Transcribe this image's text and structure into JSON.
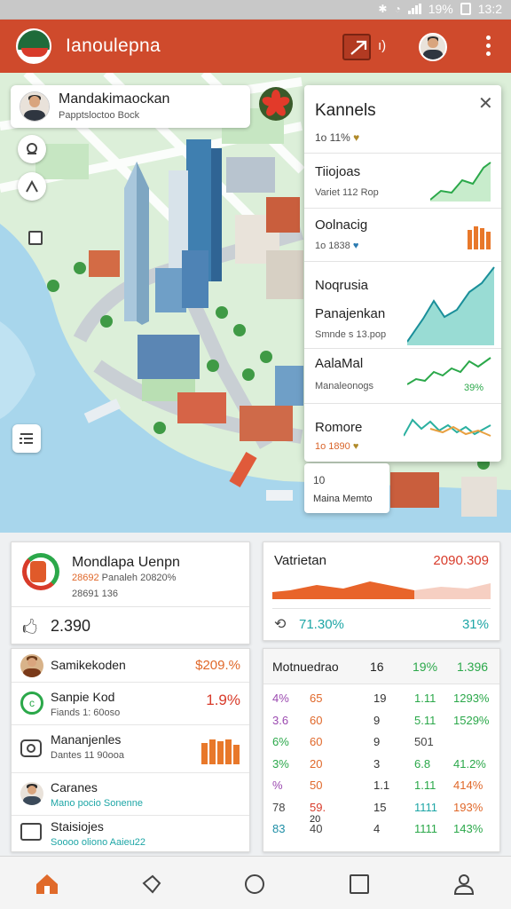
{
  "status": {
    "battery": "19%",
    "time": "13:2"
  },
  "app": {
    "title": "Ianoulepna",
    "volume_label": "ı)"
  },
  "map_card": {
    "name": "Mandakimaockan",
    "subtitle": "Papptsloctoo Bock"
  },
  "panel": {
    "title": "Kannels",
    "subtitle": "1o 11%",
    "items": [
      {
        "title": "Tiiojoas",
        "subtitle": "Variet 112 Rop"
      },
      {
        "title": "Oolnacig",
        "subtitle": "1o 1838"
      },
      {
        "title": "Noqrusia",
        "subtitle": ""
      },
      {
        "title": "Panajenkan",
        "subtitle": "Smnde s 13.pop"
      },
      {
        "title": "AalaMal",
        "subtitle": "Manaleonogs",
        "value": "39%"
      },
      {
        "title": "Romore",
        "subtitle": "1o 1890"
      }
    ]
  },
  "map_menu": {
    "line1": "10",
    "line2": "Maina Memto"
  },
  "left_card": {
    "title": "Mondlapa Uenpn",
    "sub1": "28692",
    "sub2": "Panaleh 20820%",
    "sub3": "28691 136",
    "value": "2.390"
  },
  "list": [
    {
      "title": "Samikekoden",
      "sub": "",
      "value": "$209.%"
    },
    {
      "title": "Sanpie Kod",
      "sub": "Fiands 1: 60oso",
      "value": "1.9%"
    },
    {
      "title": "Mananjenles",
      "sub": "Dantes 11 90ooa",
      "value": ""
    },
    {
      "title": "Caranes",
      "sub": "Mano pocio Sonenne",
      "value": ""
    },
    {
      "title": "Staisiojes",
      "sub": "Soooo oliono Aaieu22",
      "value": ""
    }
  ],
  "chart_card": {
    "title": "Vatrietan",
    "value": "2090.309",
    "footer_left": "71.30%",
    "footer_right": "31%"
  },
  "table": {
    "header": [
      "Motnuedrao",
      "16",
      "19%",
      "1.396"
    ],
    "rows": [
      [
        "4%",
        "65",
        "19",
        "1.11",
        "1293%"
      ],
      [
        "3.6",
        "60",
        "9",
        "5.11",
        "1529%"
      ],
      [
        "6%",
        "60",
        "9",
        "501",
        ""
      ],
      [
        "3%",
        "20",
        "3",
        "6.8",
        "41.2%"
      ],
      [
        "%",
        "50",
        "1.1",
        "1.11",
        "414%"
      ],
      [
        "78",
        "59.",
        "15",
        "1111",
        "193%"
      ],
      [
        "83",
        "40",
        "4",
        "1111",
        "143%"
      ]
    ],
    "extra": "20"
  },
  "colors": {
    "appbar": "#cf4a2c",
    "accent_orange": "#e06a2a",
    "accent_green": "#2ba84a",
    "accent_teal": "#1ea6a6",
    "map_water": "#a8d6ec"
  }
}
